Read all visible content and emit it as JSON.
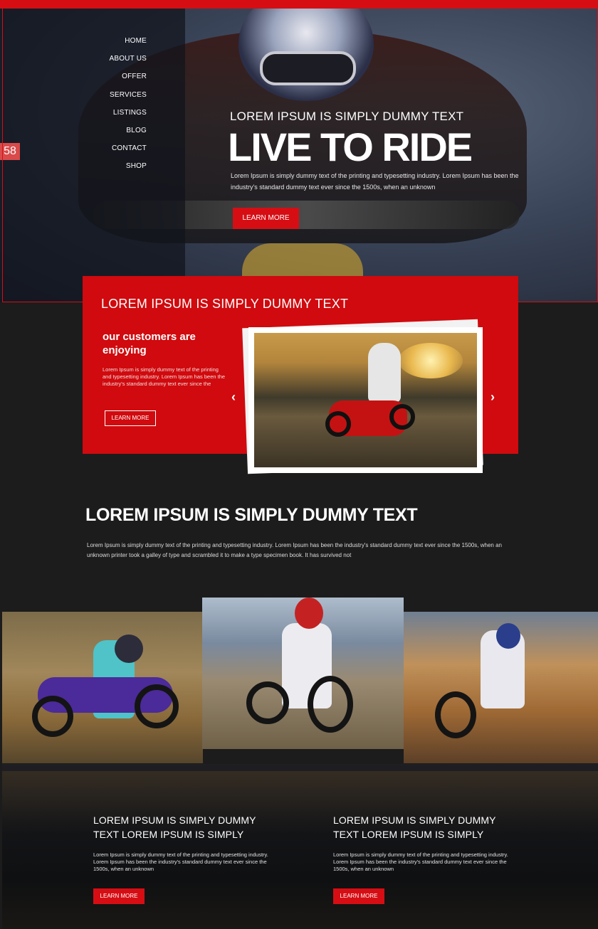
{
  "nav": {
    "items": [
      "HOME",
      "ABOUT US",
      "OFFER",
      "SERVICES",
      "LISTINGS",
      "BLOG",
      "CONTACT",
      "SHOP"
    ]
  },
  "side_badge": "58",
  "hero": {
    "subtitle": "LOREM IPSUM IS SIMPLY DUMMY TEXT",
    "title": "LIVE TO RIDE",
    "text": "Lorem Ipsum is simply dummy text of the printing and typesetting industry. Lorem Ipsum has been the industry's standard dummy text ever since the 1500s, when an unknown",
    "button": "LEARN MORE"
  },
  "feature": {
    "title": "LOREM IPSUM IS SIMPLY DUMMY TEXT",
    "subtitle": "our customers are enjoying",
    "text": "Lorem Ipsum is simply dummy text of the printing and typesetting industry. Lorem Ipsum has been the industry's standard dummy text ever since the",
    "button": "LEARN MORE",
    "prev_arrow": "‹",
    "next_arrow": "›"
  },
  "middle": {
    "title": "LOREM IPSUM IS SIMPLY DUMMY TEXT",
    "text": "Lorem Ipsum is simply dummy text of the printing and typesetting industry. Lorem Ipsum has been the industry's standard dummy text ever since the 1500s, when an unknown printer took a galley of type and scrambled it to make a type specimen book. It has survived not"
  },
  "bottom": {
    "columns": [
      {
        "title": "LOREM IPSUM IS SIMPLY DUMMY TEXT LOREM IPSUM IS SIMPLY",
        "text": "Lorem Ipsum is simply dummy text of the printing and typesetting industry. Lorem Ipsum has been the industry's standard dummy text ever since the 1500s, when an unknown",
        "button": "LEARN MORE"
      },
      {
        "title": "LOREM IPSUM IS SIMPLY DUMMY TEXT LOREM IPSUM IS SIMPLY",
        "text": "Lorem Ipsum is simply dummy text of the printing and typesetting industry. Lorem Ipsum has been the industry's standard dummy text ever since the 1500s, when an unknown",
        "button": "LEARN MORE"
      }
    ]
  },
  "colors": {
    "accent": "#d60e14",
    "background": "#1c1c1c"
  }
}
